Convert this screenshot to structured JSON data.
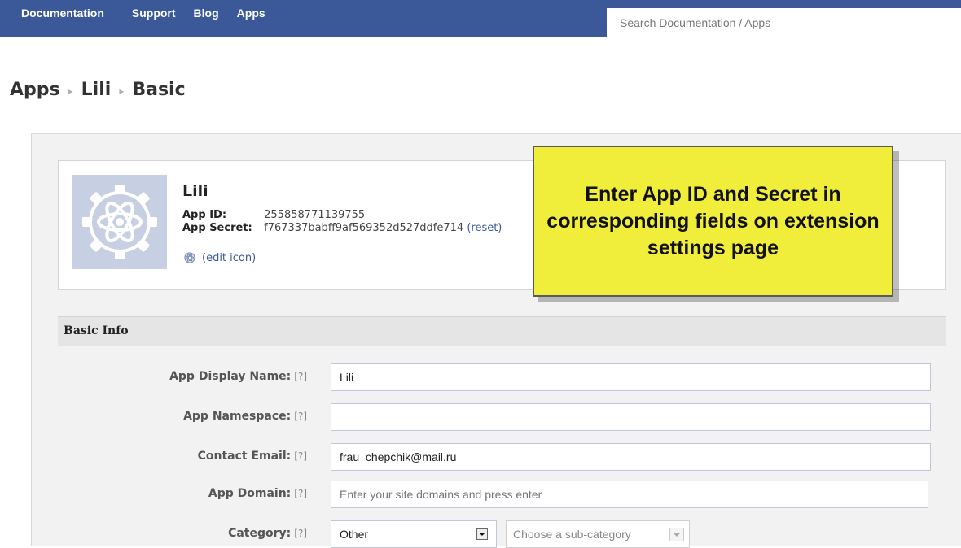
{
  "topnav": {
    "items": [
      {
        "label": "Documentation"
      },
      {
        "label": "Support"
      },
      {
        "label": "Blog"
      },
      {
        "label": "Apps"
      }
    ],
    "search_placeholder": "Search Documentation / Apps"
  },
  "breadcrumb": {
    "items": [
      "Apps",
      "Lili",
      "Basic"
    ],
    "separator": "▸"
  },
  "app_card": {
    "name": "Lili",
    "app_id_label": "App ID:",
    "app_id": "255858771139755",
    "app_secret_label": "App Secret:",
    "app_secret": "f767337babff9af569352d527ddfe714",
    "reset_label": "(reset)",
    "edit_icon_label": "(edit icon)",
    "thumbnail_icon": "atom-gear-icon"
  },
  "callout": {
    "text": "Enter App ID and Secret in corresponding fields on extension settings page",
    "background": "#f0ee3a"
  },
  "basic_info": {
    "section_title": "Basic Info",
    "help_marker": "[?]",
    "fields": {
      "display_name": {
        "label": "App Display Name:",
        "value": "Lili"
      },
      "namespace": {
        "label": "App Namespace:",
        "value": ""
      },
      "contact_email": {
        "label": "Contact Email:",
        "value": "frau_chepchik@mail.ru"
      },
      "app_domain": {
        "label": "App Domain:",
        "value": "",
        "placeholder": "Enter your site domains and press enter"
      },
      "category": {
        "label": "Category:",
        "value": "Other",
        "sub_placeholder": "Choose a sub-category"
      }
    }
  },
  "colors": {
    "nav_bg": "#3b5998",
    "link": "#3b5998",
    "panel_bg": "#f2f2f2"
  }
}
